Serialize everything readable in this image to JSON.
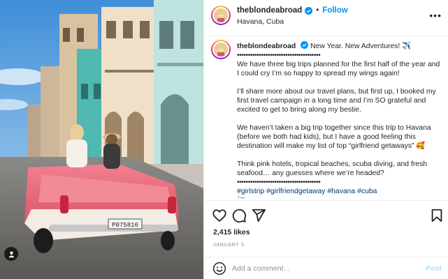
{
  "post": {
    "username": "theblondeabroad",
    "location": "Havana, Cuba",
    "follow_label": "Follow",
    "separator": "•",
    "more_label": "•••",
    "photo": {
      "plate_text": "P075816"
    }
  },
  "caption": {
    "username": "theblondeabroad",
    "headline": "New Year. New Adventures! ✈️",
    "divider": "••••••••••••••••••••••••••••••••••••••",
    "paragraphs": [
      "We have three big trips planned for the first half of the year and I could cry I’m so happy to spread my wings again!",
      "I’ll share more about our travel plans, but first up, I booked my first travel campaign in a long time and I’m SO grateful and excited to get to bring along my bestie.",
      "We haven’t taken a big trip together since this trip to Havana (before we both had kids), but I have a good feeling this destination will make my list of top “girlfriend getaways” 🥰",
      "Think pink hotels, tropical beaches, scuba diving, and fresh seafood… any guesses where we’re headed?"
    ],
    "divider2": "••••••••••••••••••••••••••••••••••••••",
    "hashtags": "#girlstrip #girlfriendgetaway #havana #cuba",
    "time_ago": "1w"
  },
  "actions": {
    "icons": [
      "heart-icon",
      "comment-icon",
      "share-icon",
      "bookmark-icon"
    ]
  },
  "stats": {
    "likes": "2,415 likes",
    "date": "JANUARY 5"
  },
  "comment": {
    "placeholder": "Add a comment...",
    "post_label": "Post"
  },
  "colors": {
    "accent": "#0095f6",
    "hashtag": "#00376b",
    "muted": "#8e8e8e",
    "post_disabled": "#b2dffc",
    "car_pink": "#e8586a"
  }
}
